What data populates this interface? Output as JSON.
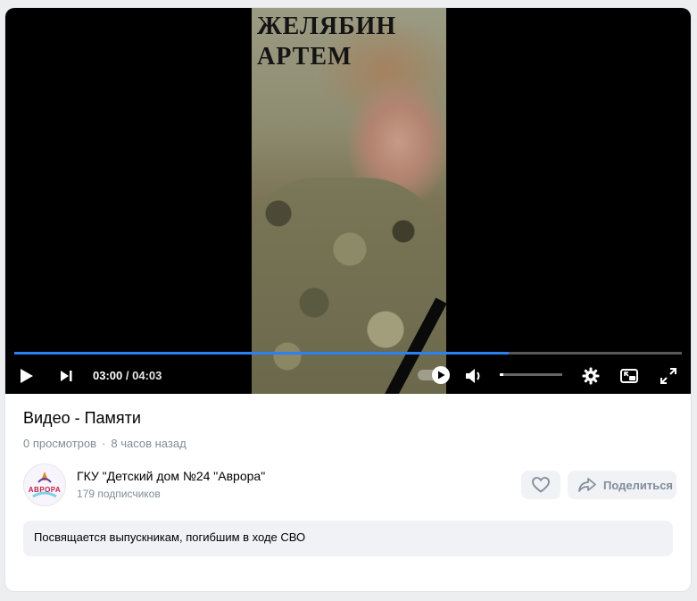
{
  "video": {
    "caption_lines": [
      "ЖЕЛЯБИН",
      "АРТЕМ"
    ],
    "current_time": "03:00",
    "separator": "/",
    "duration": "04:03",
    "progress_fraction": 0.74,
    "volume_fraction": 0.05,
    "autoplay_on": true
  },
  "details": {
    "title": "Видео - Памяти",
    "views": "0 просмотров",
    "dot": "·",
    "posted": "8 часов назад"
  },
  "channel": {
    "name": "ГКУ \"Детский дом №24 \"Аврора\"",
    "subscribers": "179 подписчиков",
    "avatar_text": "АВРОРА"
  },
  "actions": {
    "share_label": "Поделиться"
  },
  "description": "Посвящается выпускникам, погибшим в ходе СВО",
  "colors": {
    "accent": "#2b80f2",
    "muted": "#818c99",
    "button_bg": "#f0f2f5"
  },
  "icons": [
    "play-icon",
    "next-icon",
    "autoplay-toggle",
    "volume-icon",
    "gear-icon",
    "pip-icon",
    "fullscreen-icon",
    "heart-icon",
    "share-arrow-icon"
  ]
}
